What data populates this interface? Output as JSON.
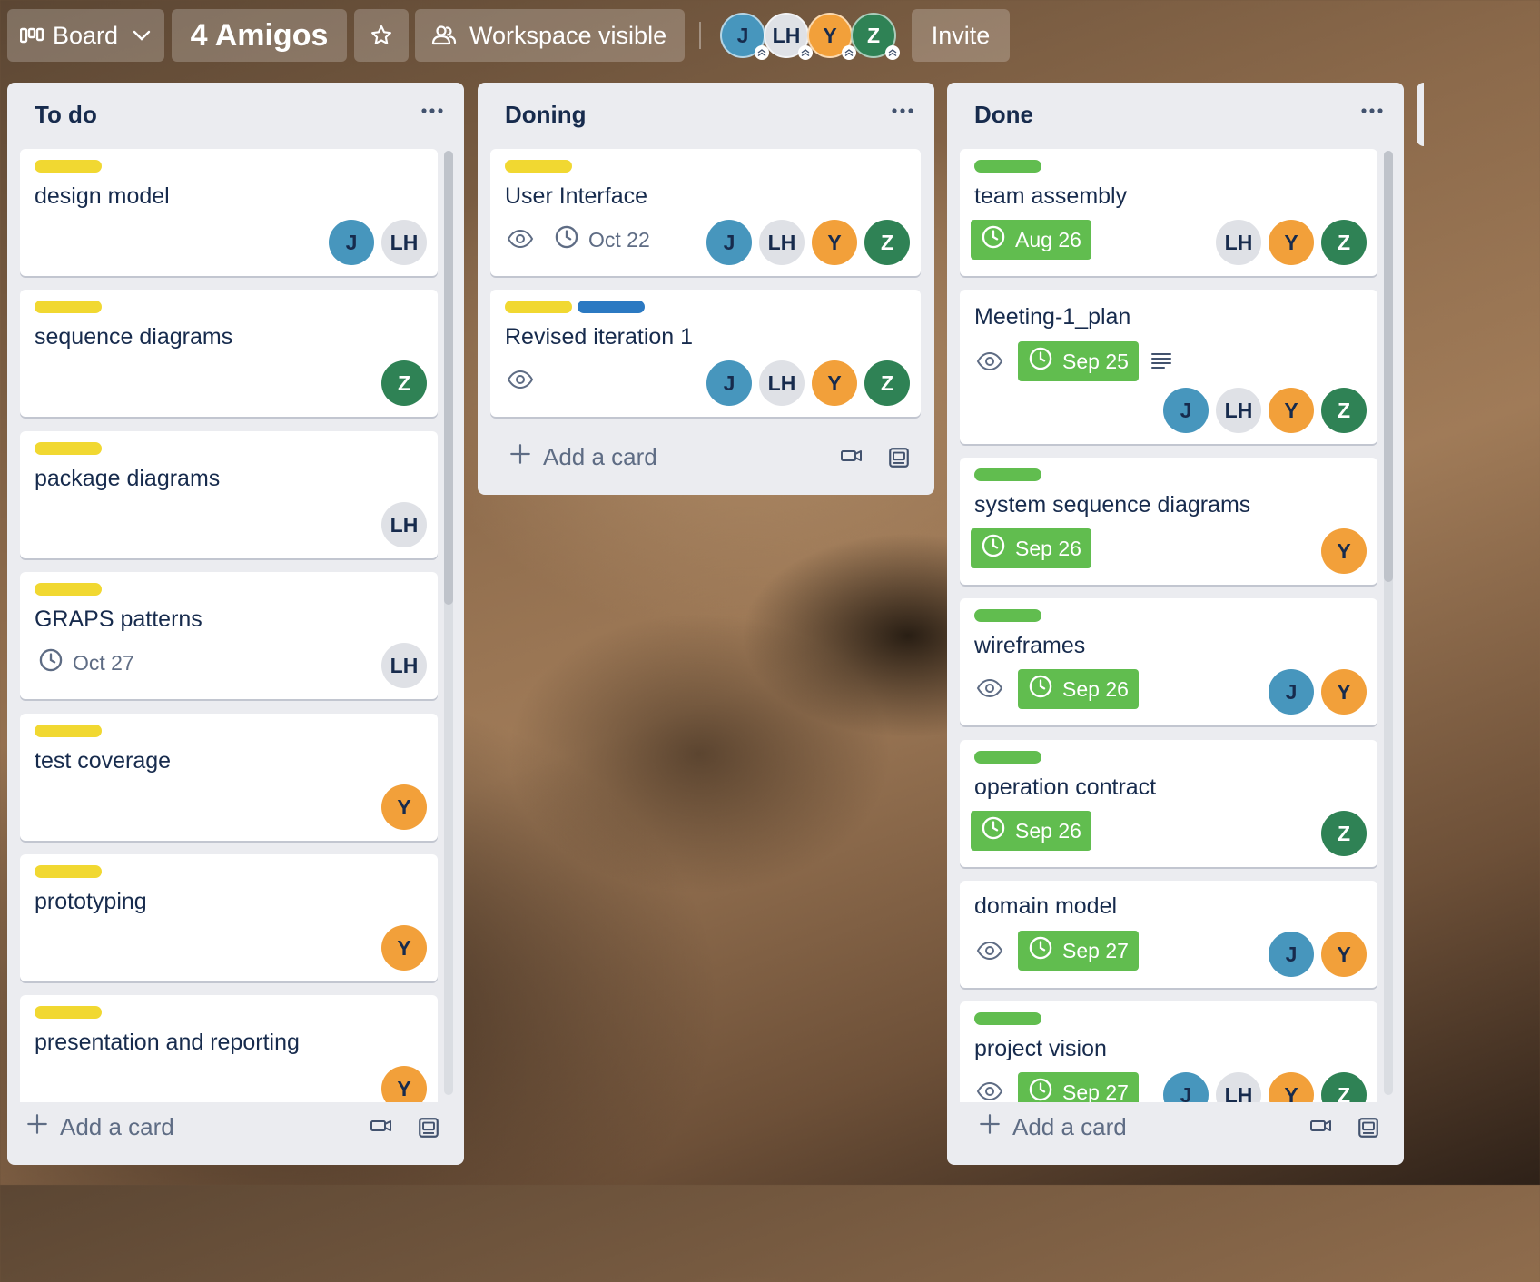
{
  "header": {
    "view_label": "Board",
    "board_name": "4 Amigos",
    "visibility_label": "Workspace visible",
    "invite_label": "Invite",
    "members": [
      "J",
      "LH",
      "Y",
      "Z"
    ]
  },
  "lists": [
    {
      "title": "To do",
      "add_card_label": "Add a card",
      "cards": [
        {
          "title": "design model",
          "labels": [
            "yellow"
          ],
          "members": [
            "J",
            "LH"
          ]
        },
        {
          "title": "sequence diagrams",
          "labels": [
            "yellow"
          ],
          "members": [
            "Z"
          ]
        },
        {
          "title": "package diagrams",
          "labels": [
            "yellow"
          ],
          "members": [
            "LH"
          ]
        },
        {
          "title": "GRAPS patterns",
          "labels": [
            "yellow"
          ],
          "due": "Oct 27",
          "members": [
            "LH"
          ]
        },
        {
          "title": "test coverage",
          "labels": [
            "yellow"
          ],
          "members": [
            "Y"
          ]
        },
        {
          "title": "prototyping",
          "labels": [
            "yellow"
          ],
          "members": [
            "Y"
          ]
        },
        {
          "title": "presentation and reporting",
          "labels": [
            "yellow"
          ],
          "members": [
            "Y"
          ]
        }
      ]
    },
    {
      "title": "Doning",
      "add_card_label": "Add a card",
      "cards": [
        {
          "title": "User Interface",
          "labels": [
            "yellow"
          ],
          "watched": true,
          "due": "Oct 22",
          "members": [
            "J",
            "LH",
            "Y",
            "Z"
          ]
        },
        {
          "title": "Revised iteration 1",
          "labels": [
            "yellow",
            "blue"
          ],
          "watched": true,
          "members": [
            "J",
            "LH",
            "Y",
            "Z"
          ]
        }
      ]
    },
    {
      "title": "Done",
      "add_card_label": "Add a card",
      "cards": [
        {
          "title": "team assembly",
          "labels": [
            "green"
          ],
          "due": "Aug 26",
          "due_complete": true,
          "members": [
            "LH",
            "Y",
            "Z"
          ]
        },
        {
          "title": "Meeting-1_plan",
          "labels": [],
          "watched": true,
          "due": "Sep 25",
          "due_complete": true,
          "has_description": true,
          "members": [
            "J",
            "LH",
            "Y",
            "Z"
          ]
        },
        {
          "title": "system sequence diagrams",
          "labels": [
            "green"
          ],
          "due": "Sep 26",
          "due_complete": true,
          "members": [
            "Y"
          ]
        },
        {
          "title": "wireframes",
          "labels": [
            "green"
          ],
          "watched": true,
          "due": "Sep 26",
          "due_complete": true,
          "members": [
            "J",
            "Y"
          ]
        },
        {
          "title": "operation contract",
          "labels": [
            "green"
          ],
          "due": "Sep 26",
          "due_complete": true,
          "members": [
            "Z"
          ]
        },
        {
          "title": "domain model",
          "labels": [],
          "watched": true,
          "due": "Sep 27",
          "due_complete": true,
          "members": [
            "J",
            "Y"
          ]
        },
        {
          "title": "project vision",
          "labels": [
            "green"
          ],
          "watched": true,
          "due": "Sep 27",
          "due_complete": true,
          "members": [
            "J",
            "LH",
            "Y",
            "Z"
          ]
        }
      ]
    }
  ],
  "colors": {
    "label_yellow": "#f1d831",
    "label_green": "#61bd4f",
    "label_blue": "#2b79c2",
    "member_J": "#4796bd",
    "member_LH": "#dfe1e6",
    "member_Y": "#f2a03a",
    "member_Z": "#2f8255"
  }
}
